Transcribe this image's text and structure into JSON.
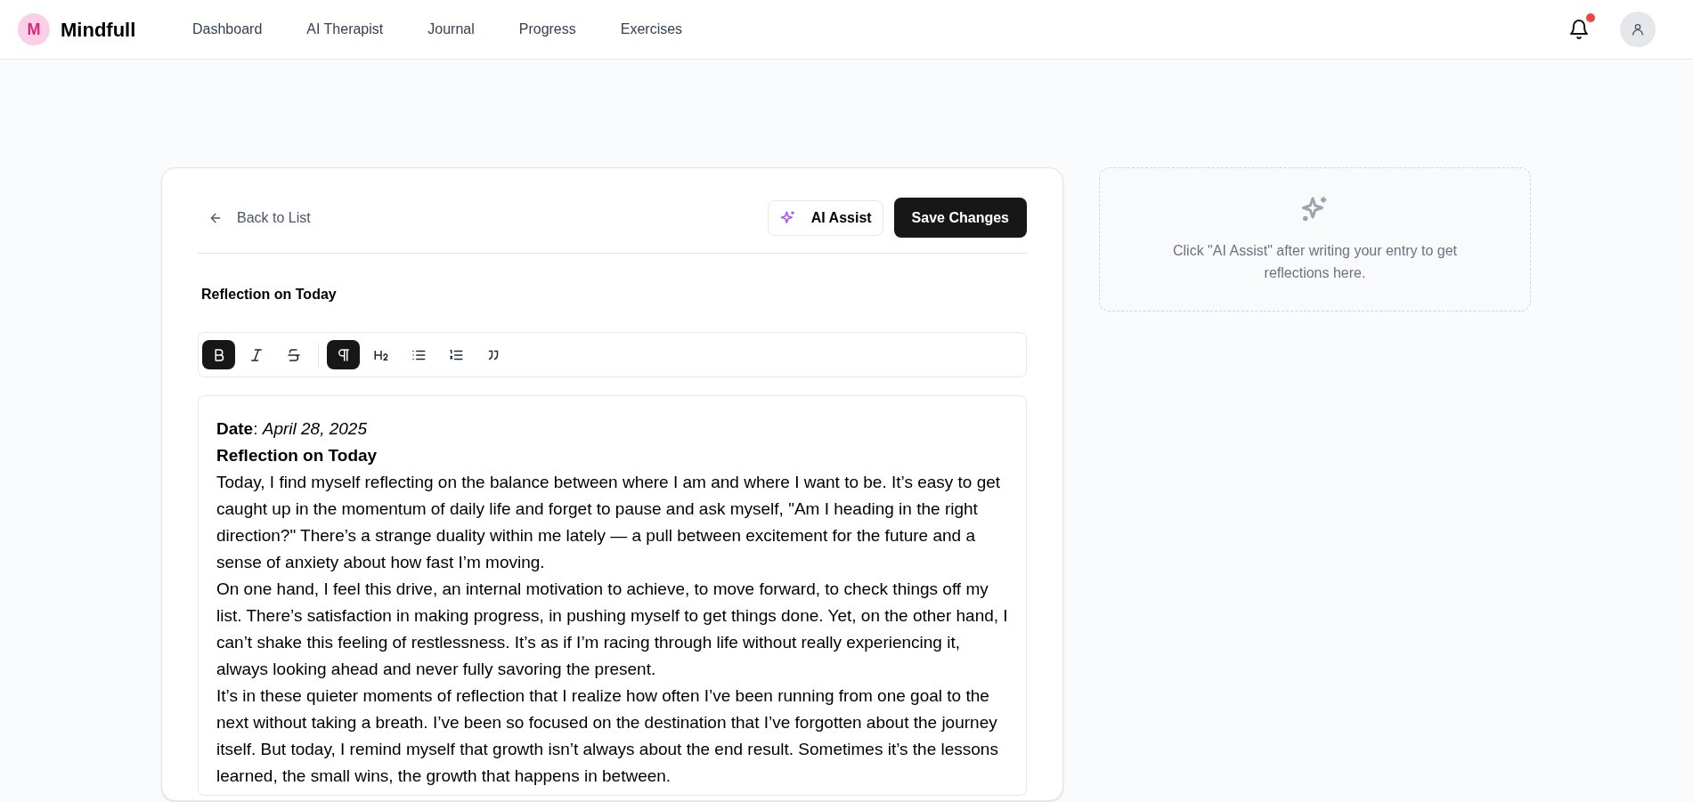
{
  "brand": {
    "initial": "M",
    "name": "Mindfull"
  },
  "nav": [
    {
      "label": "Dashboard"
    },
    {
      "label": "AI Therapist"
    },
    {
      "label": "Journal"
    },
    {
      "label": "Progress"
    },
    {
      "label": "Exercises"
    }
  ],
  "notifications": {
    "unread": true
  },
  "editor": {
    "back": "Back to List",
    "ai_button": "AI Assist",
    "save_button": "Save Changes",
    "title": "Reflection on Today",
    "toolbar": [
      {
        "kind": "bold",
        "active": true
      },
      {
        "kind": "italic",
        "active": false
      },
      {
        "kind": "strike",
        "active": false
      },
      {
        "kind": "divider"
      },
      {
        "kind": "paragraph",
        "active": true
      },
      {
        "kind": "h2",
        "active": false
      },
      {
        "kind": "bullets",
        "active": false
      },
      {
        "kind": "numbered",
        "active": false
      },
      {
        "kind": "quote",
        "active": false
      }
    ],
    "content": [
      {
        "kind": "line",
        "text": "**Date**: *April 28, 2025*"
      },
      {
        "kind": "heading",
        "text": "Reflection on Today"
      },
      {
        "kind": "paragraph",
        "text": "Today, I find myself reflecting on the balance between where I am and where I want to be. It’s easy to get caught up in the momentum of daily life and forget to pause and ask myself, \"Am I heading in the right direction?\" There’s a strange duality within me lately — a pull between excitement for the future and a sense of anxiety about how fast I’m moving."
      },
      {
        "kind": "paragraph",
        "text": "On one hand, I feel this drive, an internal motivation to achieve, to move forward, to check things off my list. There’s satisfaction in making progress, in pushing myself to get things done. Yet, on the other hand, I can’t shake this feeling of restlessness. It’s as if I’m racing through life without really experiencing it, always looking ahead and never fully savoring the present."
      },
      {
        "kind": "paragraph",
        "text": "It’s in these quieter moments of reflection that I realize how often I’ve been running from one goal to the next without taking a breath. I’ve been so focused on the destination that I’ve forgotten about the journey itself. But today, I remind myself that growth isn’t always about the end result. Sometimes it’s the lessons learned, the small wins, the growth that happens in between."
      }
    ]
  },
  "assist_panel": {
    "message": "Click \"AI Assist\" after writing your entry to get reflections here."
  }
}
